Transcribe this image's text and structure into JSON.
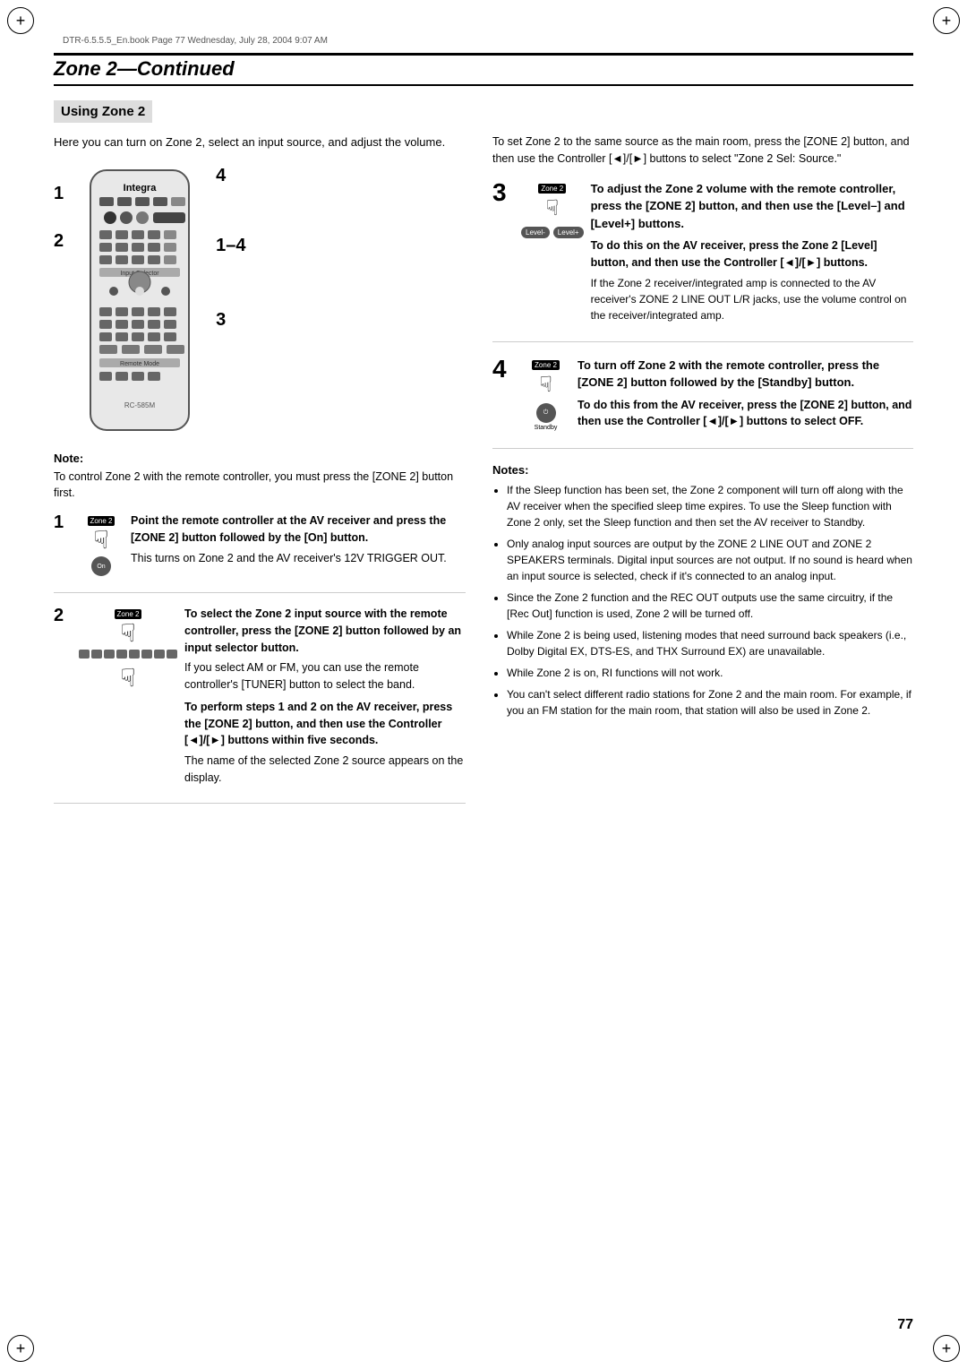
{
  "meta": {
    "file_info": "DTR-6.5.5.5_En.book  Page 77  Wednesday, July 28, 2004  9:07 AM"
  },
  "page": {
    "title": "Zone 2",
    "title_suffix": "—Continued",
    "number": "77"
  },
  "subsection": {
    "title": "Using Zone 2"
  },
  "intro": "Here you can turn on Zone 2, select an input source, and adjust the volume.",
  "diagram_labels": {
    "left1": "1",
    "left2": "2",
    "right4": "4",
    "right14": "1–4",
    "right3": "3"
  },
  "note_before_steps": {
    "title": "Note:",
    "text": "To control Zone 2 with the remote controller, you must press the [ZONE 2] button first."
  },
  "left_steps": [
    {
      "num": "1",
      "bold_text": "Point the remote controller at the AV receiver and press the [ZONE 2] button followed by the [On] button.",
      "body_text": "This turns on Zone 2 and the AV receiver's 12V TRIGGER OUT."
    },
    {
      "num": "2",
      "bold_text": "To select the Zone 2 input source with the remote controller, press the [ZONE 2] button followed by an input selector button.",
      "body_text1": "If you select AM or FM, you can use the remote controller's [TUNER] button to select the band.",
      "bold_text2": "To perform steps 1 and 2 on the AV receiver, press the [ZONE 2] button, and then use the Controller [◄]/[►] buttons within five seconds.",
      "body_text2": "The name of the selected Zone 2 source appears on the display."
    }
  ],
  "right_intro": "To set Zone 2 to the same source as the main room, press the [ZONE 2] button, and then use the Controller [◄]/[►] buttons to select \"Zone 2 Sel: Source.\"",
  "right_steps": [
    {
      "num": "3",
      "bold_header": "To adjust the Zone 2 volume with the remote controller, press the [ZONE 2] button, and then use the [Level–] and [Level+] buttons.",
      "sub_bold": "To do this on the AV receiver, press the Zone 2 [Level] button, and then use the Controller [◄]/[►] buttons.",
      "body_text": "If the Zone 2 receiver/integrated amp is connected to the AV receiver's ZONE 2 LINE OUT L/R jacks, use the volume control on the receiver/integrated amp."
    },
    {
      "num": "4",
      "bold_header": "To turn off Zone 2 with the remote controller, press the [ZONE 2] button followed by the [Standby] button.",
      "sub_bold": "To do this from the AV receiver, press the [ZONE 2] button, and then use the Controller [◄]/[►] buttons to select OFF."
    }
  ],
  "notes_section": {
    "title": "Notes:",
    "items": [
      "If the Sleep function has been set, the Zone 2 component will turn off along with the AV receiver when the specified sleep time expires. To use the Sleep function with Zone 2 only, set the Sleep function and then set the AV receiver to Standby.",
      "Only analog input sources are output by the ZONE 2 LINE OUT and ZONE 2 SPEAKERS terminals. Digital input sources are not output. If no sound is heard when an input source is selected, check if it's connected to an analog input.",
      "Since the Zone 2 function and the REC OUT outputs use the same circuitry, if the [Rec Out] function is used, Zone 2 will be turned off.",
      "While Zone 2 is being used, listening modes that need surround back speakers (i.e., Dolby Digital EX, DTS-ES, and THX Surround EX) are unavailable.",
      "While Zone 2 is on, RI functions will not work.",
      "You can't select different radio stations for Zone 2 and the main room. For example, if you an FM station for the main room, that station will also be used in Zone 2."
    ]
  }
}
